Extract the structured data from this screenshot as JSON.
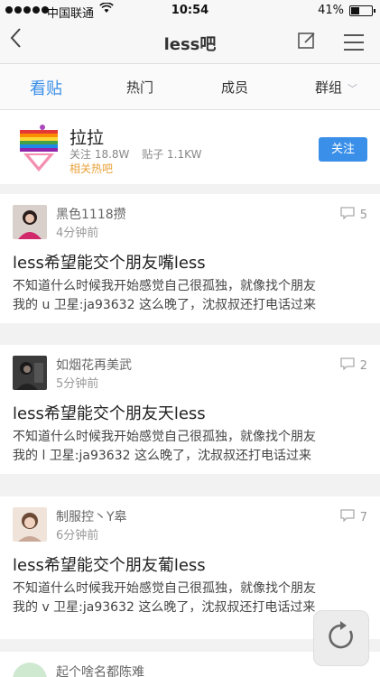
{
  "status": {
    "carrier": "中国联通",
    "time": "10:54",
    "battery": "41%",
    "battery_level": 0.41
  },
  "nav": {
    "title": "less吧"
  },
  "tabs": [
    {
      "label": "看贴"
    },
    {
      "label": "热门"
    },
    {
      "label": "成员"
    },
    {
      "label": "群组"
    }
  ],
  "forum": {
    "name": "拉拉",
    "followers": "关注 18.8W",
    "posts": "贴子 1.1KW",
    "related": "相关热吧",
    "follow_label": "关注"
  },
  "posts": [
    {
      "author": "黑色1118攒",
      "time": "4分钟前",
      "replies": "5",
      "title": "less希望能交个朋友嘴less",
      "body_line1": "不知道什么时候我开始感觉自己很孤独，就像找个朋友",
      "body_line2": "我的 u 卫星:ja93632 这么晚了，沈叔叔还打电话过来"
    },
    {
      "author": "如烟花再美武",
      "time": "5分钟前",
      "replies": "2",
      "title": "less希望能交个朋友天less",
      "body_line1": "不知道什么时候我开始感觉自己很孤独，就像找个朋友",
      "body_line2": "我的 l 卫星:ja93632 这么晚了，沈叔叔还打电话过来"
    },
    {
      "author": "制服控丶Y皋",
      "time": "6分钟前",
      "replies": "7",
      "title": "less希望能交个朋友葡less",
      "body_line1": "不知道什么时候我开始感觉自己很孤独，就像找个朋友",
      "body_line2": "我的 v 卫星:ja93632 这么晚了，沈叔叔还打电话过来"
    },
    {
      "author": "起个啥名都陈难"
    }
  ],
  "colors": {
    "accent": "#3a8fe8",
    "related": "#e8a23a"
  }
}
